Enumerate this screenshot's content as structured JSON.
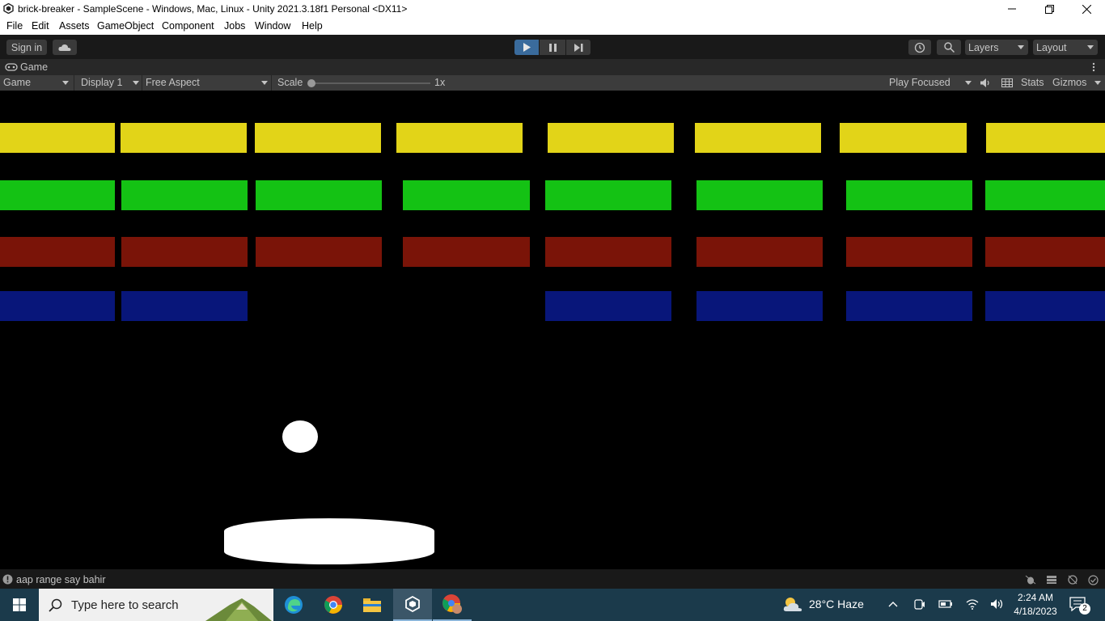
{
  "window": {
    "title": "brick-breaker - SampleScene - Windows, Mac, Linux - Unity 2021.3.18f1 Personal <DX11>"
  },
  "menu": [
    "File",
    "Edit",
    "Assets",
    "GameObject",
    "Component",
    "Jobs",
    "Window",
    "Help"
  ],
  "toolbar": {
    "sign_in": "Sign in",
    "layers": "Layers",
    "layout": "Layout"
  },
  "tab": {
    "label": "Game"
  },
  "game_toolbar": {
    "view_mode": "Game",
    "display": "Display 1",
    "aspect": "Free Aspect",
    "scale_label": "Scale",
    "scale_value": "1x",
    "play_focused": "Play Focused",
    "stats": "Stats",
    "gizmos": "Gizmos"
  },
  "colors": {
    "yellow": "#e2d418",
    "green": "#14c214",
    "red": "#7a1408",
    "blue": "#08167a",
    "play_active": "#3a6b9c"
  },
  "bricks": {
    "yellow_row": [
      1,
      1,
      1,
      1,
      1,
      1,
      1,
      1
    ],
    "green_row": [
      1,
      1,
      1,
      1,
      1,
      1,
      1,
      1
    ],
    "red_row": [
      1,
      1,
      1,
      1,
      1,
      1,
      1,
      1
    ],
    "blue_row": [
      1,
      1,
      0,
      0,
      1,
      1,
      1,
      1
    ]
  },
  "status": {
    "message": "aap range say bahir"
  },
  "taskbar": {
    "search_placeholder": "Type here to search",
    "weather": "28°C  Haze",
    "time": "2:24 AM",
    "date": "4/18/2023",
    "notifications": "2"
  }
}
